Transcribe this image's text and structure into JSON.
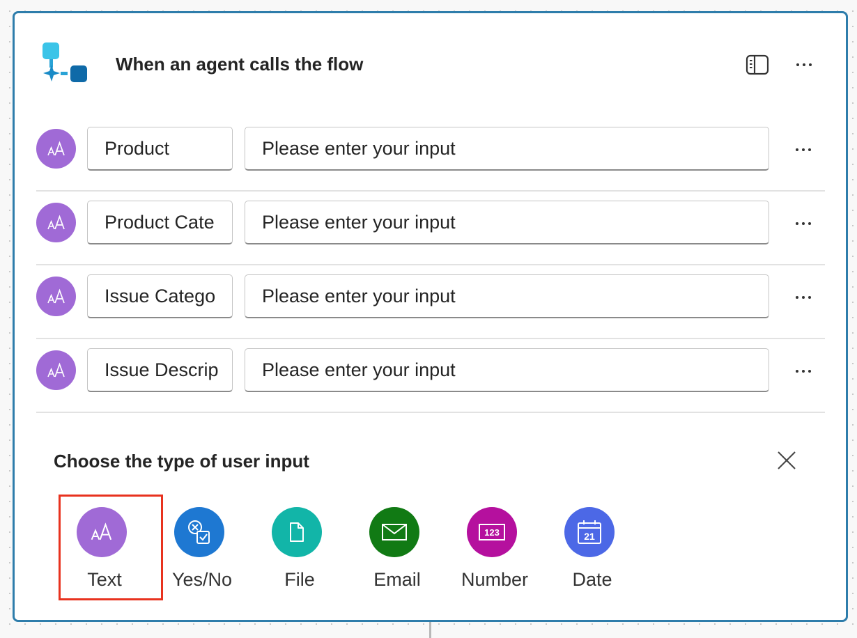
{
  "header": {
    "title": "When an agent calls the flow",
    "icons": {
      "flow": "flow-trigger-icon",
      "panel": "side-panel-icon",
      "more": "more-icon"
    }
  },
  "inputs": [
    {
      "name": "Product",
      "value_placeholder": "Please enter your input",
      "type_icon": "text-icon"
    },
    {
      "name": "Product Cate",
      "value_placeholder": "Please enter your input",
      "type_icon": "text-icon"
    },
    {
      "name": "Issue Catego",
      "value_placeholder": "Please enter your input",
      "type_icon": "text-icon"
    },
    {
      "name": "Issue Descrip",
      "value_placeholder": "Please enter your input",
      "type_icon": "text-icon"
    }
  ],
  "chooser": {
    "title": "Choose the type of user input",
    "close_icon": "close-icon",
    "selected": "Text",
    "options": [
      {
        "label": "Text",
        "icon": "text-icon",
        "color": "#a06ad6"
      },
      {
        "label": "Yes/No",
        "icon": "yes-no-icon",
        "color": "#1e78d2"
      },
      {
        "label": "File",
        "icon": "file-icon",
        "color": "#12b5a8"
      },
      {
        "label": "Email",
        "icon": "email-icon",
        "color": "#117a14"
      },
      {
        "label": "Number",
        "icon": "number-icon",
        "color": "#b5109e"
      },
      {
        "label": "Date",
        "icon": "calendar-icon",
        "color": "#4c68e6"
      }
    ],
    "number_icon_text": "123",
    "date_icon_text": "21"
  },
  "colors": {
    "card_border": "#2e7dab",
    "flow_icon_light": "#3bc4e8",
    "flow_icon_dark": "#0f6aa8",
    "selection_frame": "#e8321e"
  }
}
